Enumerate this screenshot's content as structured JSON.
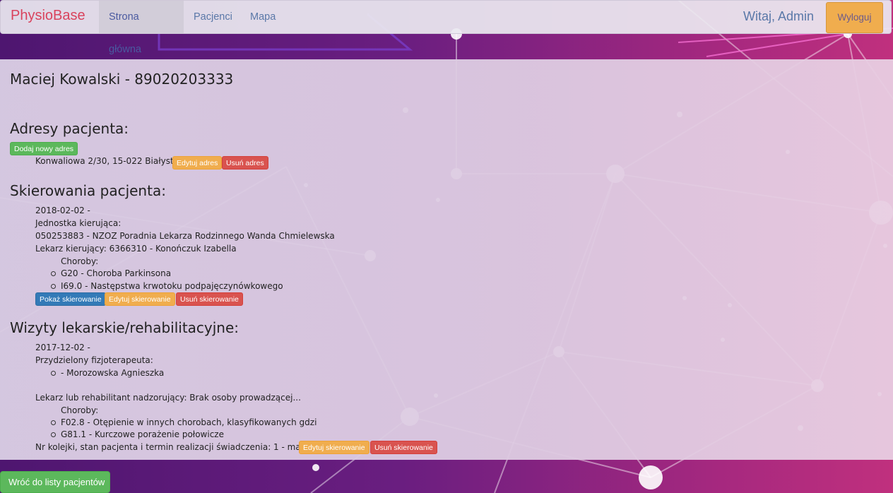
{
  "navbar": {
    "brand": "PhysioBase",
    "links": [
      "Strona główna",
      "Pacjenci",
      "Mapa"
    ],
    "greeting": "Witaj, Admin",
    "logout": "Wyloguj"
  },
  "patient": {
    "title": "Maciej Kowalski - 89020203333"
  },
  "addresses": {
    "heading": "Adresy pacjenta:",
    "add_button": "Dodaj nowy adres",
    "items": [
      {
        "text": "Konwaliowa 2/30, 15-022 Białystok",
        "edit": "Edytuj adres",
        "delete": "Usuń adres"
      }
    ]
  },
  "referrals": {
    "heading": "Skierowania pacjenta:",
    "items": [
      {
        "date": "2018-02-02 -",
        "unit_label": "Jednostka kierująca:",
        "unit": "050253883 - NZOZ Poradnia Lekarza Rodzinnego Wanda Chmielewska",
        "doctor": "Lekarz kierujący: 6366310 - Konończuk Izabella",
        "diseases_label": "Choroby:",
        "diseases": [
          "G20 - Choroba Parkinsona",
          "I69.0 - Następstwa krwotoku podpajęczynówkowego"
        ],
        "show": "Pokaż skierowanie",
        "edit": "Edytuj skierowanie",
        "delete": "Usuń skierowanie"
      }
    ]
  },
  "visits": {
    "heading": "Wizyty lekarskie/rehabilitacyjne:",
    "items": [
      {
        "date": "2017-12-02 -",
        "physio_label": "Przydzielony fizjoterapeuta:",
        "physios": [
          "- Morozowska Agnieszka"
        ],
        "supervisor": "Lekarz lub rehabilitant nadzorujący: Brak osoby prowadzącej...",
        "diseases_label": "Choroby:",
        "diseases": [
          "F02.8 - Otępienie w innych chorobach, klasyfikowanych gdzi",
          "G81.1 - Kurczowe porażenie połowicze"
        ],
        "queue": "Nr kolejki, stan pacjenta i termin realizacji świadczenia: 1 - maj 2019",
        "edit": "Edytuj skierowanie",
        "delete": "Usuń skierowanie"
      }
    ]
  },
  "footer": {
    "back": "Wróć do listy pacjentów"
  },
  "colors": {
    "brand": "#d9435d",
    "nav_link": "#5a78a8",
    "success": "#5cb85c",
    "warning": "#f0ad4e",
    "danger": "#d9534f",
    "primary": "#337ab7"
  }
}
